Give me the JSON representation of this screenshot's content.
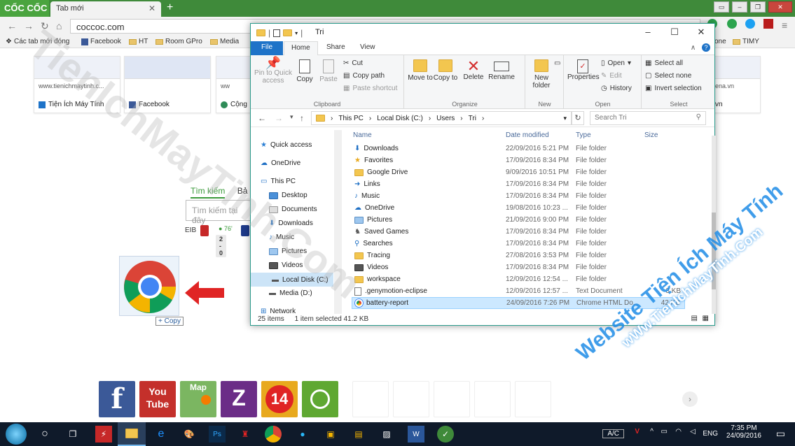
{
  "browser": {
    "brand": "CỐC CỐC",
    "tab_title": "Tab mới",
    "tab_close": "✕",
    "new_tab": "+",
    "address": "coccoc.com",
    "bookmarks": [
      {
        "label": "Các tab mới đóng"
      },
      {
        "label": "Facebook"
      },
      {
        "label": "HT"
      },
      {
        "label": "Room GPro"
      },
      {
        "label": "Media"
      },
      {
        "label": "one"
      },
      {
        "label": "TIMY"
      }
    ]
  },
  "speed_dial": [
    {
      "url": "www.tienichmaytinh.c...",
      "title": "Tiện Ích Máy Tính"
    },
    {
      "url": "",
      "title": "Facebook"
    },
    {
      "url": "ww",
      "title": "Cộng"
    },
    {
      "url": "ena.vn",
      "title": "vn"
    }
  ],
  "search": {
    "tab_active": "Tìm kiếm",
    "tab_other": "Bả",
    "placeholder": "Tìm kiếm tại đây"
  },
  "score": {
    "team": "EIB",
    "minute": "76'",
    "result": "2 - 0"
  },
  "drag": {
    "copy_label": "Copy"
  },
  "app_tiles": [
    {
      "label": "f",
      "color": "#3b5998"
    },
    {
      "label": "You Tube",
      "color": "#c4302b"
    },
    {
      "label": "Map",
      "color": "#7bb661"
    },
    {
      "label": "Z",
      "color": "#6b2d87"
    },
    {
      "label": "14",
      "color": "#e8a91e"
    },
    {
      "label": "",
      "color": "#5fa832"
    }
  ],
  "explorer": {
    "title": "Tri",
    "ribbon_tabs": [
      "File",
      "Home",
      "Share",
      "View"
    ],
    "clipboard": {
      "pin": "Pin to Quick access",
      "copy": "Copy",
      "paste": "Paste",
      "cut": "Cut",
      "copy_path": "Copy path",
      "paste_shortcut": "Paste shortcut",
      "label": "Clipboard"
    },
    "organize": {
      "move": "Move to",
      "copy": "Copy to",
      "delete": "Delete",
      "rename": "Rename",
      "label": "Organize"
    },
    "new": {
      "folder": "New folder",
      "label": "New"
    },
    "open": {
      "properties": "Properties",
      "open": "Open",
      "edit": "Edit",
      "history": "History",
      "label": "Open"
    },
    "select": {
      "all": "Select all",
      "none": "Select none",
      "invert": "Invert selection",
      "label": "Select"
    },
    "breadcrumb": [
      "This PC",
      "Local Disk (C:)",
      "Users",
      "Tri"
    ],
    "search_placeholder": "Search Tri",
    "nav": [
      {
        "label": "Quick access",
        "icon": "star-icon"
      },
      {
        "label": "OneDrive",
        "icon": "cloud-icon"
      },
      {
        "label": "This PC",
        "icon": "pc-icon"
      },
      {
        "label": "Desktop",
        "icon": "desktop-icon"
      },
      {
        "label": "Documents",
        "icon": "documents-icon"
      },
      {
        "label": "Downloads",
        "icon": "download-icon"
      },
      {
        "label": "Music",
        "icon": "music-icon"
      },
      {
        "label": "Pictures",
        "icon": "pictures-icon"
      },
      {
        "label": "Videos",
        "icon": "videos-icon"
      },
      {
        "label": "Local Disk (C:)",
        "icon": "disk-icon"
      },
      {
        "label": "Media (D:)",
        "icon": "disk-icon"
      },
      {
        "label": "Network",
        "icon": "network-icon"
      }
    ],
    "columns": [
      "Name",
      "Date modified",
      "Type",
      "Size"
    ],
    "files": [
      {
        "name": "Downloads",
        "date": "22/09/2016 5:21 PM",
        "type": "File folder",
        "size": ""
      },
      {
        "name": "Favorites",
        "date": "17/09/2016 8:34 PM",
        "type": "File folder",
        "size": ""
      },
      {
        "name": "Google Drive",
        "date": "9/09/2016 10:51 PM",
        "type": "File folder",
        "size": ""
      },
      {
        "name": "Links",
        "date": "17/09/2016 8:34 PM",
        "type": "File folder",
        "size": ""
      },
      {
        "name": "Music",
        "date": "17/09/2016 8:34 PM",
        "type": "File folder",
        "size": ""
      },
      {
        "name": "OneDrive",
        "date": "19/08/2016 10:23 ...",
        "type": "File folder",
        "size": ""
      },
      {
        "name": "Pictures",
        "date": "21/09/2016 9:00 PM",
        "type": "File folder",
        "size": ""
      },
      {
        "name": "Saved Games",
        "date": "17/09/2016 8:34 PM",
        "type": "File folder",
        "size": ""
      },
      {
        "name": "Searches",
        "date": "17/09/2016 8:34 PM",
        "type": "File folder",
        "size": ""
      },
      {
        "name": "Tracing",
        "date": "27/08/2016 3:53 PM",
        "type": "File folder",
        "size": ""
      },
      {
        "name": "Videos",
        "date": "17/09/2016 8:34 PM",
        "type": "File folder",
        "size": ""
      },
      {
        "name": "workspace",
        "date": "12/09/2016 12:54 ...",
        "type": "File folder",
        "size": ""
      },
      {
        "name": ".genymotion-eclipse",
        "date": "12/09/2016 12:57 ...",
        "type": "Text Document",
        "size": "3 KB"
      },
      {
        "name": "battery-report",
        "date": "24/09/2016 7:26 PM",
        "type": "Chrome HTML Do...",
        "size": "42 KB"
      }
    ],
    "status": {
      "count": "25 items",
      "selected": "1 item selected  41.2 KB"
    }
  },
  "watermark": {
    "diag": "TienIchMayTinh.Com",
    "blue_line1": "Website Tiện Ích Máy Tính",
    "blue_line2": "wWw.TienIchMayTinh.Com"
  },
  "taskbar": {
    "ime": "A/C",
    "lang": "ENG",
    "time": "7:35 PM",
    "date": "24/09/2016"
  }
}
